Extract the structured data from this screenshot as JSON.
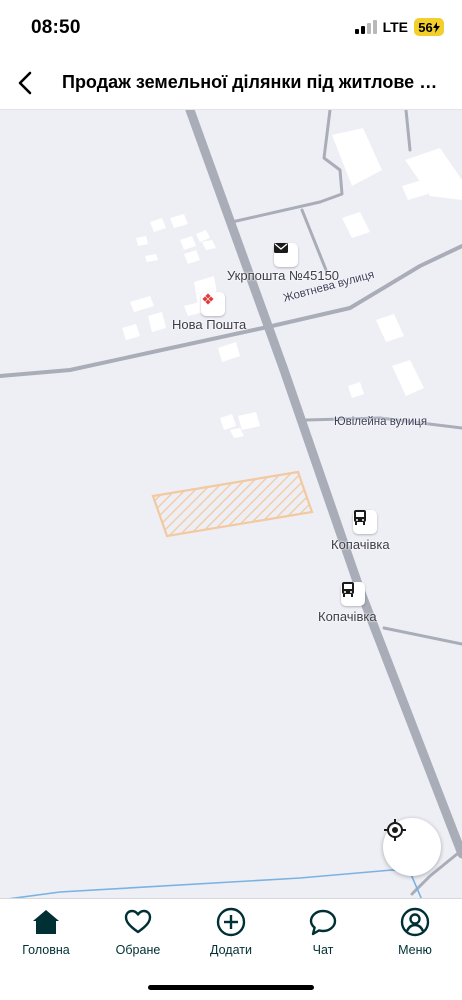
{
  "status_bar": {
    "time": "08:50",
    "network": "LTE",
    "battery": "56"
  },
  "header": {
    "title": "Продаж земельної ділянки під житлове будівництво"
  },
  "map": {
    "pois": [
      {
        "name": "Укрпошта №45150",
        "icon": "mail-icon"
      },
      {
        "name": "Нова Пошта",
        "icon": "nova-poshta-icon"
      },
      {
        "name": "Копачівка",
        "icon": "bus-stop-icon"
      },
      {
        "name": "Копачівка",
        "icon": "bus-stop-icon"
      }
    ],
    "streets": [
      "Жовтнева вулиця",
      "Ювілейна вулиця"
    ],
    "plot_color": "#f2c9a0",
    "road_color": "#a9adb8"
  },
  "tabbar": {
    "items": [
      {
        "label": "Головна",
        "icon": "home-icon"
      },
      {
        "label": "Обране",
        "icon": "heart-icon"
      },
      {
        "label": "Додати",
        "icon": "plus-circle-icon"
      },
      {
        "label": "Чат",
        "icon": "chat-icon"
      },
      {
        "label": "Меню",
        "icon": "user-icon"
      }
    ]
  }
}
